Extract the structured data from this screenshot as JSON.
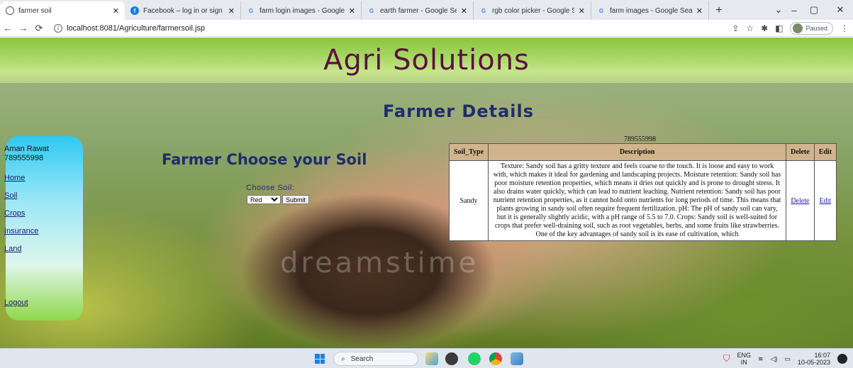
{
  "browser": {
    "tabs": [
      {
        "title": "farmer soil",
        "icon": "globe-icon",
        "active": true
      },
      {
        "title": "Facebook – log in or sign up",
        "icon": "facebook-icon"
      },
      {
        "title": "farm login images - Google",
        "icon": "google-icon"
      },
      {
        "title": "earth farmer - Google Search",
        "icon": "google-icon"
      },
      {
        "title": "rgb color picker - Google S",
        "icon": "google-icon"
      },
      {
        "title": "farm images - Google Search",
        "icon": "google-icon"
      }
    ],
    "url": "localhost:8081/Agriculture/farmersoil.jsp",
    "profile_status": "Paused"
  },
  "page": {
    "site_title": "Agri Solutions",
    "section_title": "Farmer Details",
    "sidebar": {
      "user_name": "Aman Rawat",
      "user_phone": "789555998",
      "links": [
        "Home",
        "Soil",
        "Crops",
        "Insurance",
        "Land"
      ],
      "logout": "Logout"
    },
    "choose": {
      "title": "Farmer Choose your Soil",
      "label": "Choose Soil:",
      "selected": "Red",
      "submit": "Submit"
    },
    "table": {
      "caption": "789555998",
      "headers": [
        "Soil_Type",
        "Description",
        "Delete",
        "Edit"
      ],
      "row": {
        "soil_type": "Sandy",
        "description": "Texture: Sandy soil has a gritty texture and feels coarse to the touch. It is loose and easy to work with, which makes it ideal for gardening and landscaping projects. Moisture retention: Sandy soil has poor moisture retention properties, which means it dries out quickly and is prone to drought stress. It also drains water quickly, which can lead to nutrient leaching. Nutrient retention: Sandy soil has poor nutrient retention properties, as it cannot hold onto nutrients for long periods of time. This means that plants growing in sandy soil often require frequent fertilization. pH: The pH of sandy soil can vary, but it is generally slightly acidic, with a pH range of 5.5 to 7.0. Crops: Sandy soil is well-suited for crops that prefer well-draining soil, such as root vegetables, herbs, and some fruits like strawberries. One of the key advantages of sandy soil is its ease of cultivation, which",
        "delete": "Delete",
        "edit": "Edit"
      }
    },
    "watermark": "dreamstime"
  },
  "taskbar": {
    "search_placeholder": "Search",
    "lang_top": "ENG",
    "lang_bottom": "IN",
    "time": "16:07",
    "date": "10-05-2023"
  }
}
